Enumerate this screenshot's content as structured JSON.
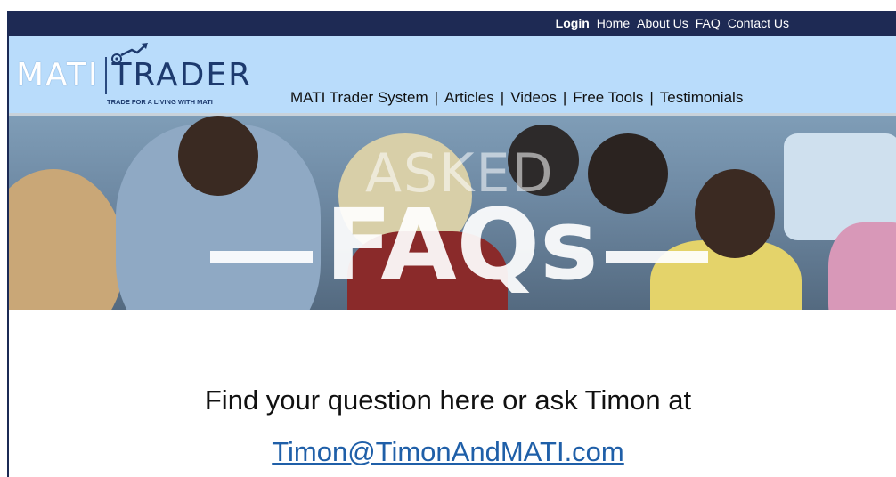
{
  "top_nav": {
    "links": [
      "Login",
      "Home",
      "About Us",
      "FAQ",
      "Contact Us"
    ]
  },
  "logo": {
    "brand_left": "MATI",
    "brand_right": "TRADER",
    "tagline": "TRADE FOR A LIVING WITH MATI"
  },
  "main_nav": {
    "items": [
      "MATI Trader System",
      "Articles",
      "Videos",
      "Free Tools",
      "Testimonials"
    ],
    "separator": "|"
  },
  "hero": {
    "line1": "ASKED",
    "line2": "FAQs"
  },
  "content": {
    "prompt": "Find your question here or ask Timon at",
    "email": "Timon@TimonAndMATI.com"
  },
  "colors": {
    "top_bar": "#1e2a54",
    "header": "#b9dcfb",
    "link": "#1f5fa8"
  }
}
